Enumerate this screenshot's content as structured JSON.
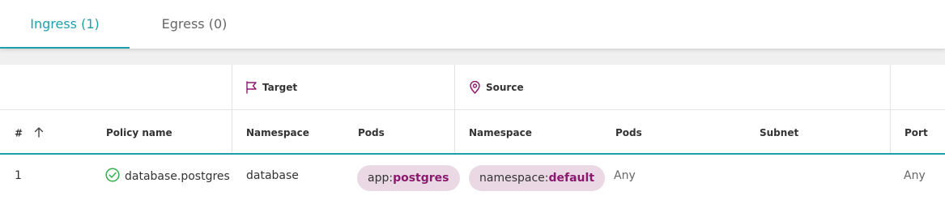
{
  "tabs": [
    {
      "label": "Ingress (1)",
      "active": true
    },
    {
      "label": "Egress (0)",
      "active": false
    }
  ],
  "table": {
    "groups": {
      "target": "Target",
      "source": "Source"
    },
    "columns": {
      "index": "#",
      "policy_name": "Policy name",
      "target_namespace": "Namespace",
      "target_pods": "Pods",
      "source_namespace": "Namespace",
      "source_pods": "Pods",
      "source_subnet": "Subnet",
      "port": "Port"
    },
    "rows": [
      {
        "index": "1",
        "policy_name": "database.postgres",
        "status": "ok",
        "target_namespace": "database",
        "target_pods": {
          "key": "app:",
          "value": "postgres"
        },
        "source_namespace": {
          "key": "namespace:",
          "value": "default"
        },
        "source_pods": "Any",
        "source_subnet": "",
        "port": "Any"
      }
    ]
  },
  "icons": {
    "target": "flag-icon",
    "source": "location-pin-icon",
    "sort": "arrow-up-icon",
    "status": "check-circle-icon"
  },
  "colors": {
    "accent": "#1e9fae",
    "chip_bg": "#ead8e5",
    "chip_value": "#8b1a6e",
    "status_ok": "#2fb14c",
    "icon_group": "#8b1a6e"
  }
}
